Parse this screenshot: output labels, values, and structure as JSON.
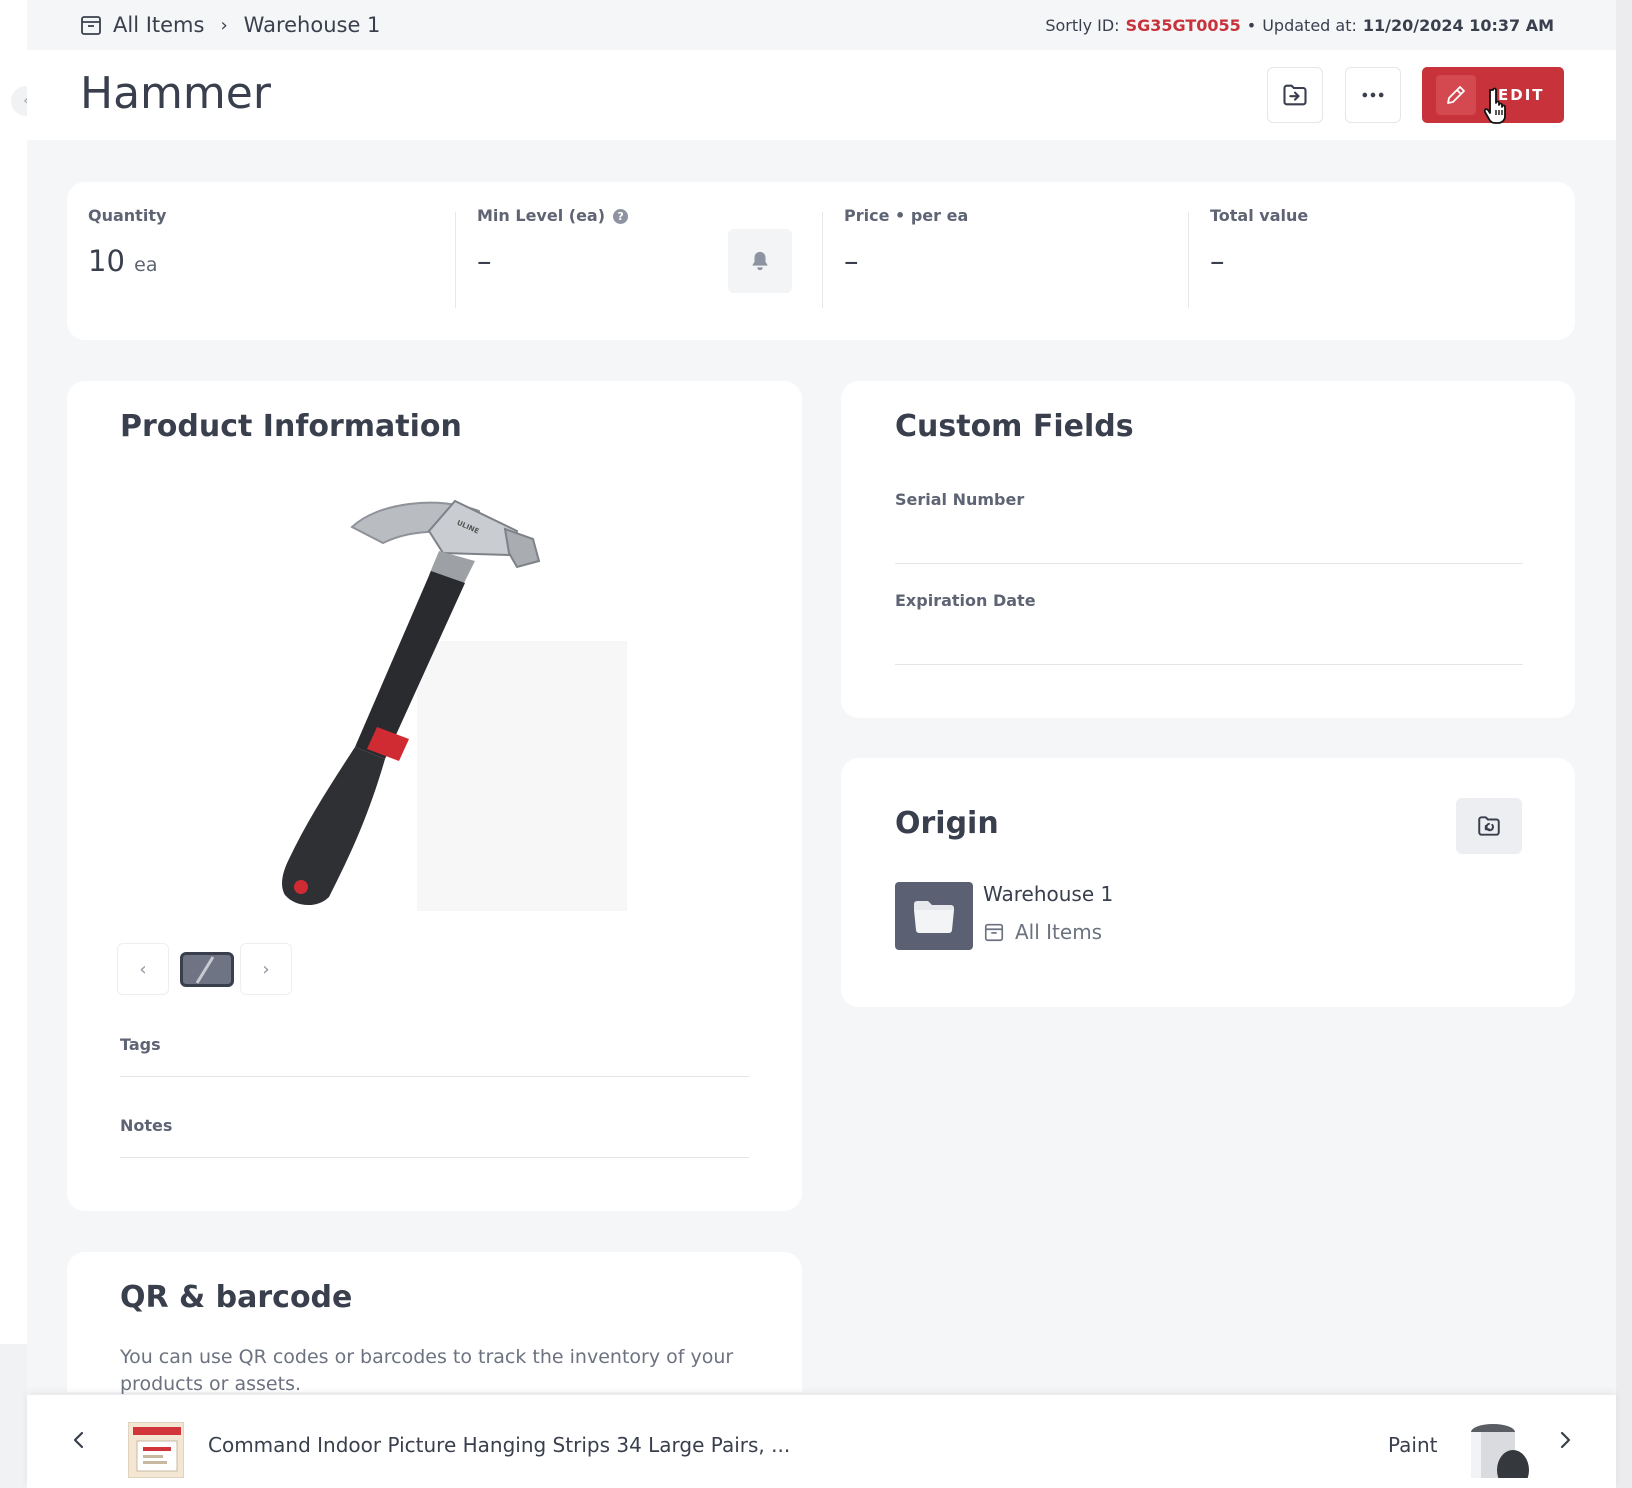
{
  "breadcrumb": {
    "root": "All Items",
    "current": "Warehouse 1"
  },
  "meta": {
    "sortly_id_label": "Sortly ID:",
    "sortly_id": "SG35GT0055",
    "bullet": "•",
    "updated_label": "Updated at:",
    "updated_at": "11/20/2024 10:37 AM"
  },
  "item": {
    "title": "Hammer"
  },
  "actions": {
    "edit_label": "EDIT"
  },
  "stats": {
    "quantity": {
      "label": "Quantity",
      "value": "10",
      "unit": "ea"
    },
    "min_level": {
      "label": "Min Level (ea)",
      "value": "–"
    },
    "price": {
      "label": "Price",
      "bullet": "•",
      "unit_label": "per ea",
      "value": "–"
    },
    "total_value": {
      "label": "Total value",
      "value": "–"
    }
  },
  "product_info": {
    "title": "Product Information",
    "image_brand": "ULINE",
    "tags_label": "Tags",
    "notes_label": "Notes"
  },
  "custom_fields": {
    "title": "Custom Fields",
    "fields": [
      {
        "label": "Serial Number"
      },
      {
        "label": "Expiration Date"
      }
    ]
  },
  "origin": {
    "title": "Origin",
    "folder_name": "Warehouse 1",
    "parent_name": "All Items"
  },
  "qr": {
    "title": "QR & barcode",
    "description": "You can use QR codes or barcodes to track the inventory of your products or assets."
  },
  "footer_nav": {
    "prev_item": "Command Indoor Picture Hanging Strips 34 Large Pairs, ...",
    "next_item": "Paint"
  },
  "colors": {
    "brand_red": "#c8323b",
    "text_dark": "#393f4d",
    "background": "#f5f6f8",
    "folder_tile": "#5b6173"
  }
}
